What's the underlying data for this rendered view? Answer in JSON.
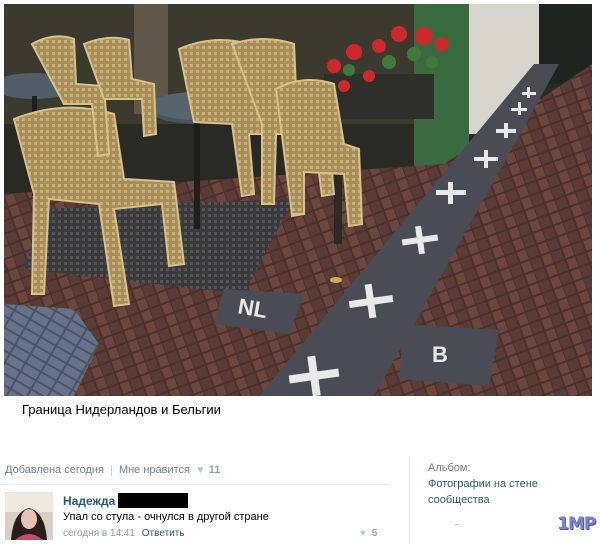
{
  "photo": {
    "alt_icon": "cafe-border-photo",
    "tile_labels": {
      "left": "NL",
      "right": "B"
    },
    "colors": {
      "bricks": "#5a3b35",
      "border_slabs": "#4d4f58",
      "chairs": "#b39a66",
      "table_top": "#3e4f5a",
      "flowers": "#cc2a2a"
    }
  },
  "caption": "Граница Нидерландов и Бельгии",
  "post_meta": {
    "added": "Добавлена сегодня",
    "separator": "|",
    "like_label": "Мне нравится",
    "like_icon": "heart-icon",
    "like_count": "11"
  },
  "album": {
    "label": "Альбом:",
    "name": "Фотографии на стене сообщества"
  },
  "comment": {
    "author": "Надежда",
    "text": "Упал со стула - очнулся в другой стране",
    "date": "сегодня в 14:41",
    "reply_label": "Ответить",
    "like_icon": "heart-icon",
    "like_count": "5"
  },
  "watermark": "1MP"
}
